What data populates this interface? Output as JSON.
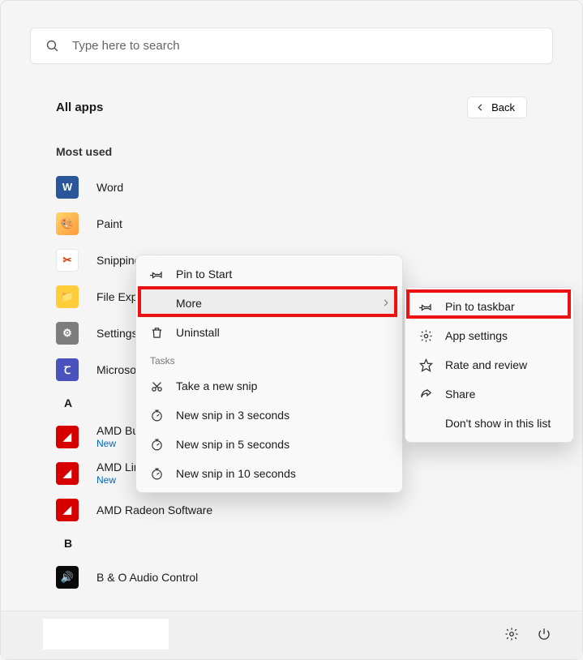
{
  "search": {
    "placeholder": "Type here to search"
  },
  "header": {
    "title": "All apps",
    "back_label": "Back"
  },
  "section_label": "Most used",
  "apps": [
    {
      "label": "Word",
      "new": false,
      "icon_bg": "#2b579a",
      "icon_fg": "#ffffff",
      "icon_text": "W",
      "name": "app-word"
    },
    {
      "label": "Paint",
      "new": false,
      "icon_bg": "#ffe07a",
      "icon_fg": "#1d80d0",
      "icon_text": "🎨",
      "name": "app-paint"
    },
    {
      "label": "Snipping Tool",
      "new": false,
      "icon_bg": "#ffffff",
      "icon_fg": "#d83b01",
      "icon_text": "✂",
      "name": "app-snipping-tool"
    },
    {
      "label": "File Explorer",
      "new": false,
      "icon_bg": "#ffcd3a",
      "icon_fg": "#7a5a00",
      "icon_text": "📁",
      "name": "app-file-explorer"
    },
    {
      "label": "Settings",
      "new": false,
      "icon_bg": "#7d7d7d",
      "icon_fg": "#ffffff",
      "icon_text": "⚙",
      "name": "app-settings"
    },
    {
      "label": "Microsoft Teams",
      "new": false,
      "icon_bg": "#4a52bd",
      "icon_fg": "#ffffff",
      "icon_text": "Ꞇ",
      "name": "app-microsoft-teams"
    }
  ],
  "letter_a": "A",
  "apps_a": [
    {
      "label": "AMD Bug Report Tool",
      "new": true,
      "new_label": "New",
      "icon_bg": "#d60000",
      "icon_fg": "#ffffff",
      "icon_text": "◢",
      "name": "app-amd-bug-report"
    },
    {
      "label": "AMD Link",
      "new": true,
      "new_label": "New",
      "icon_bg": "#d60000",
      "icon_fg": "#ffffff",
      "icon_text": "◢",
      "name": "app-amd-link"
    },
    {
      "label": "AMD Radeon Software",
      "new": false,
      "icon_bg": "#d60000",
      "icon_fg": "#ffffff",
      "icon_text": "◢",
      "name": "app-amd-radeon-software"
    }
  ],
  "letter_b": "B",
  "apps_b": [
    {
      "label": "B & O Audio Control",
      "new": false,
      "icon_bg": "#0a0a0a",
      "icon_fg": "#2a88ff",
      "icon_text": "◀",
      "name": "app-bo-audio-control"
    }
  ],
  "ctx1": {
    "pin_start": "Pin to Start",
    "more": "More",
    "uninstall": "Uninstall",
    "tasks_label": "Tasks",
    "take_snip": "Take a new snip",
    "snip3": "New snip in 3 seconds",
    "snip5": "New snip in 5 seconds",
    "snip10": "New snip in 10 seconds"
  },
  "ctx2": {
    "pin_taskbar": "Pin to taskbar",
    "app_settings": "App settings",
    "rate": "Rate and review",
    "share": "Share",
    "dont_show": "Don't show in this list"
  },
  "colors": {
    "highlight": "#e11"
  }
}
